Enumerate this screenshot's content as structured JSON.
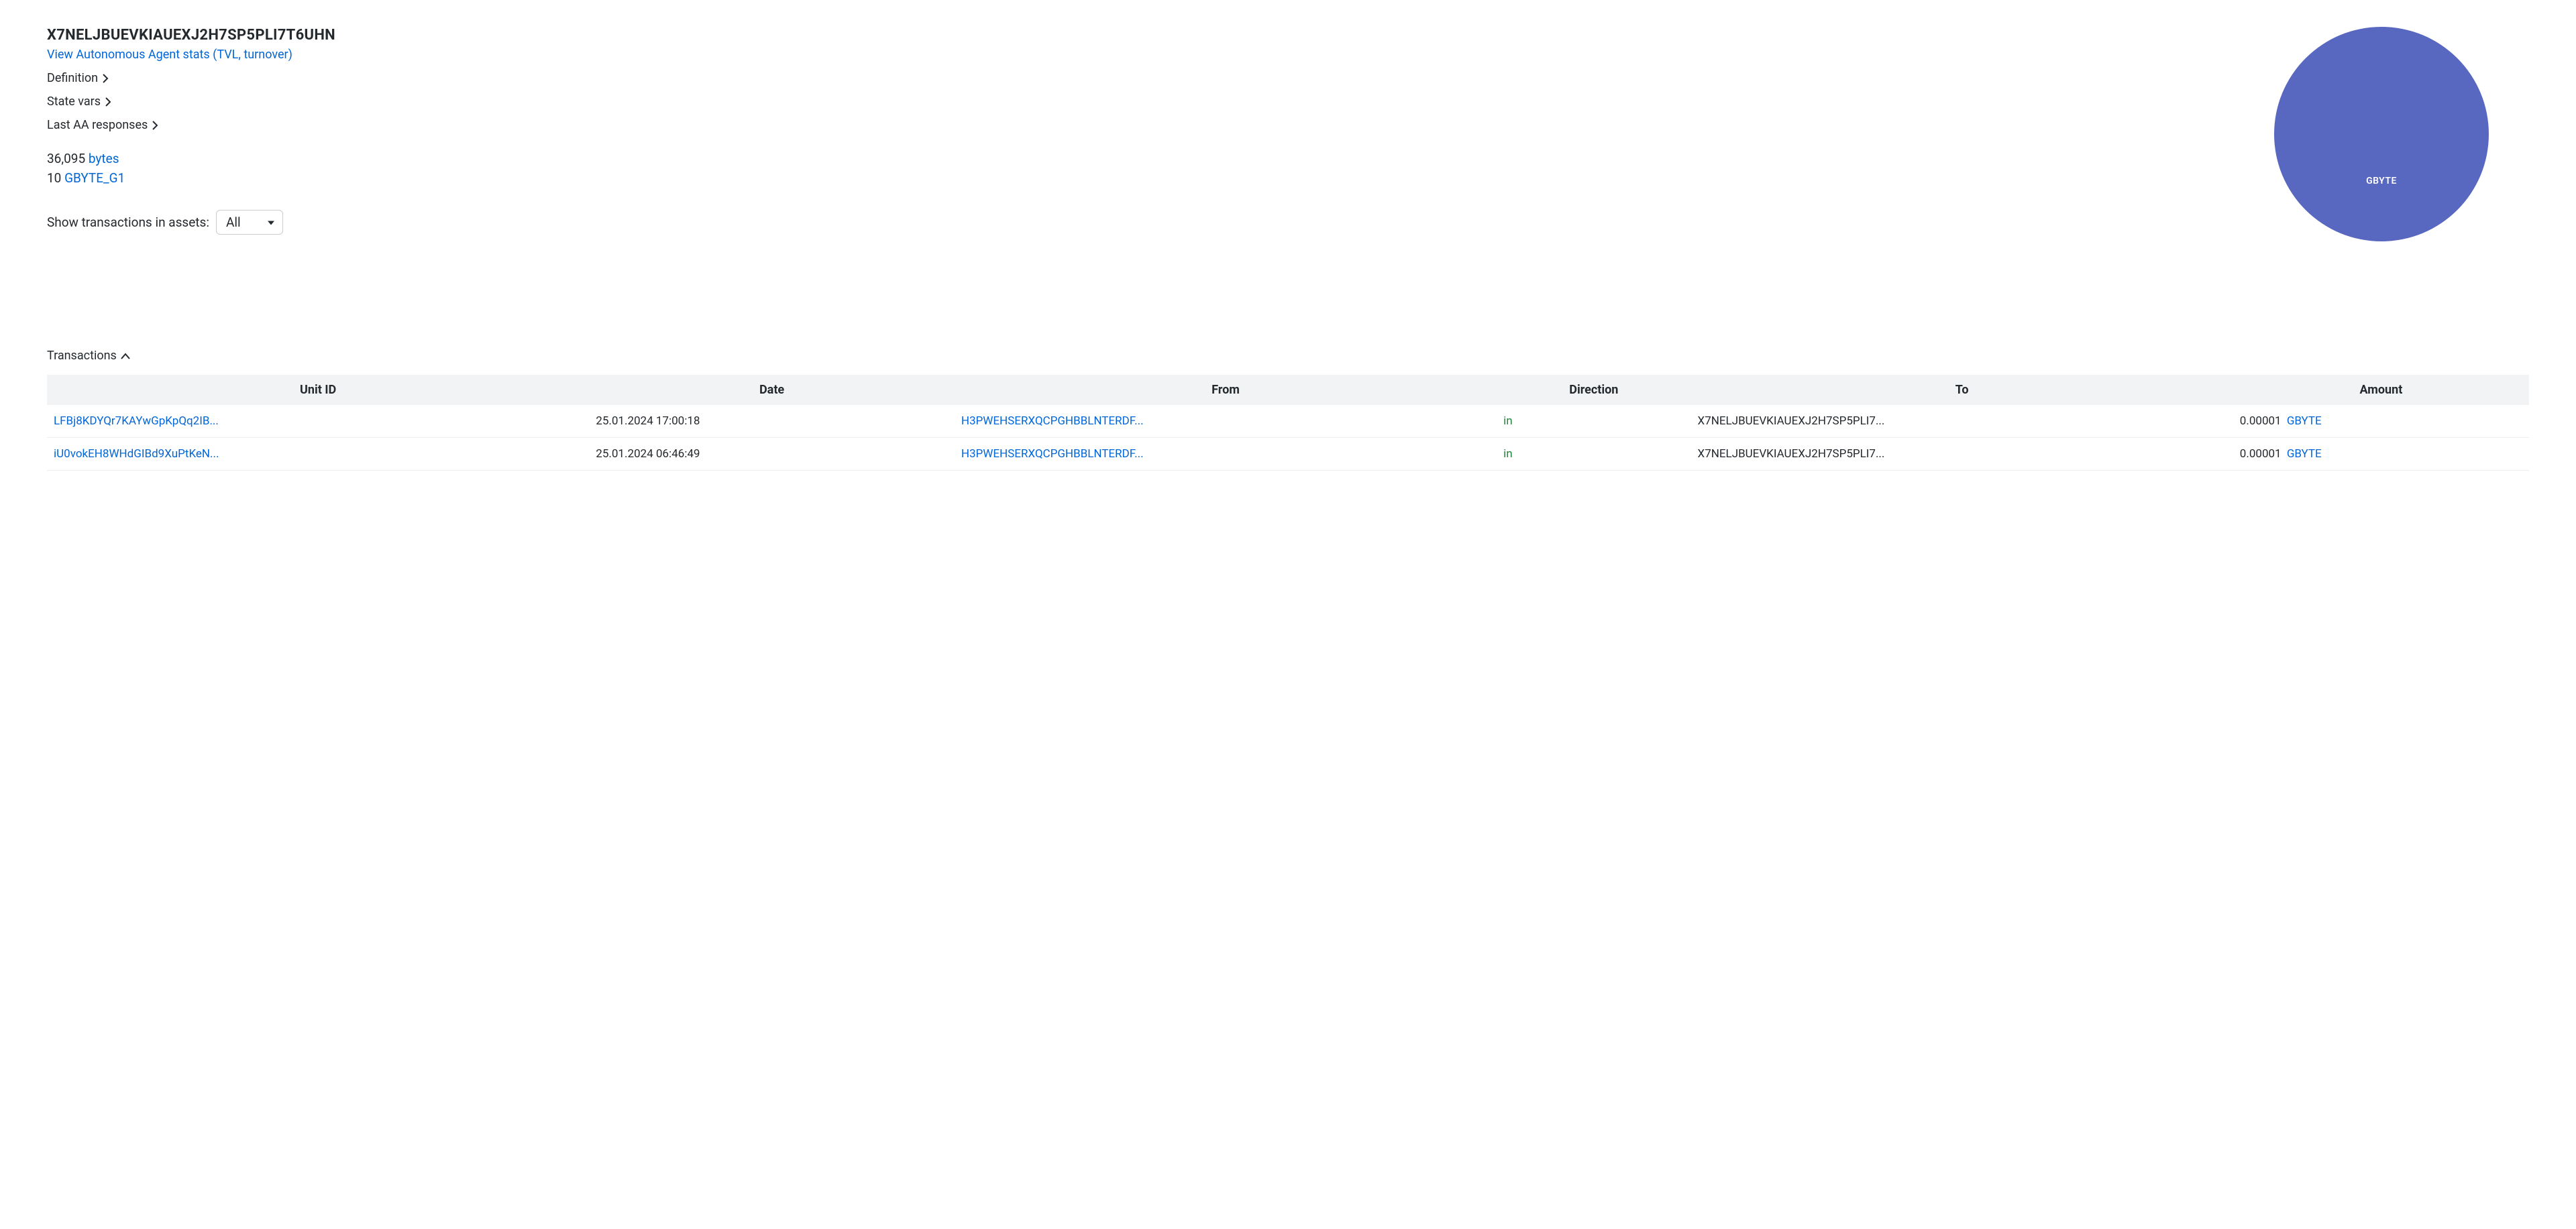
{
  "address": "X7NELJBUEVKIAUEXJ2H7SP5PLI7T6UHN",
  "links": {
    "aa_stats": "View Autonomous Agent stats (TVL, turnover)"
  },
  "expanders": {
    "definition": "Definition",
    "state_vars": "State vars",
    "last_responses": "Last AA responses"
  },
  "balances": [
    {
      "amount": "36,095",
      "asset": "bytes"
    },
    {
      "amount": "10",
      "asset": "GBYTE_G1"
    }
  ],
  "filter": {
    "label": "Show transactions in assets:",
    "selected": "All"
  },
  "chart_data": {
    "type": "pie",
    "slices": [
      {
        "name": "GBYTE",
        "value": 100,
        "color": "#5867c0"
      }
    ]
  },
  "transactions": {
    "heading": "Transactions",
    "columns": [
      "Unit ID",
      "Date",
      "From",
      "Direction",
      "To",
      "Amount"
    ],
    "rows": [
      {
        "unit": "LFBj8KDYQr7KAYwGpKpQq2IB...",
        "date": "25.01.2024 17:00:18",
        "from": "H3PWEHSERXQCPGHBBLNTERDF...",
        "direction": "in",
        "to": "X7NELJBUEVKIAUEXJ2H7SP5PLI7...",
        "amount": "0.00001",
        "amount_asset": "GBYTE"
      },
      {
        "unit": "iU0vokEH8WHdGIBd9XuPtKeN...",
        "date": "25.01.2024 06:46:49",
        "from": "H3PWEHSERXQCPGHBBLNTERDF...",
        "direction": "in",
        "to": "X7NELJBUEVKIAUEXJ2H7SP5PLI7...",
        "amount": "0.00001",
        "amount_asset": "GBYTE"
      }
    ]
  }
}
